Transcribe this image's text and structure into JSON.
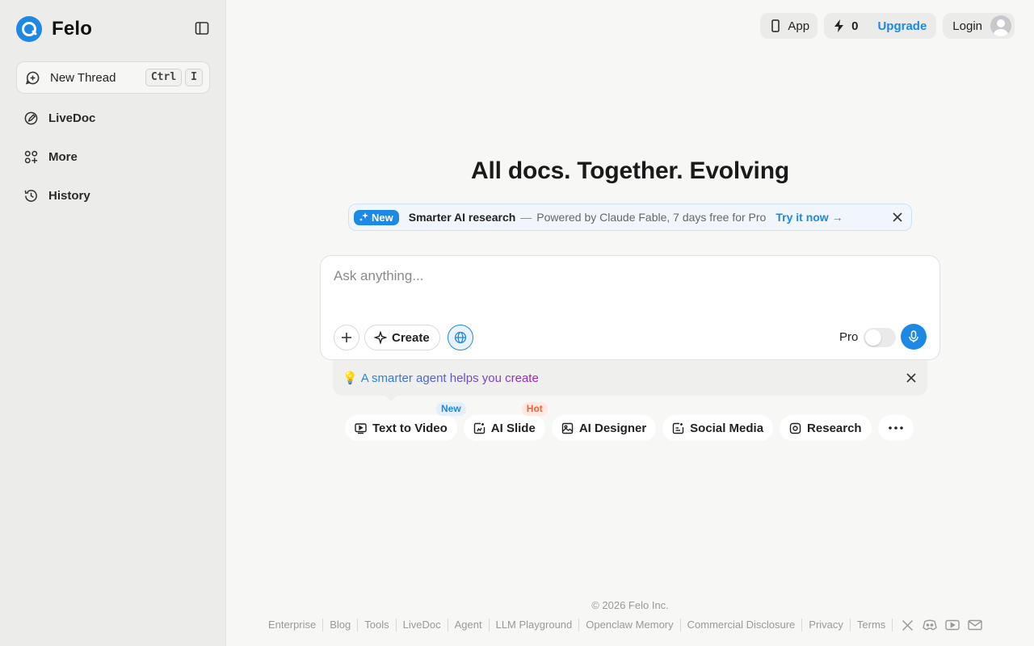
{
  "brand": {
    "name": "Felo"
  },
  "sidebar": {
    "new_thread": {
      "label": "New Thread",
      "keys": [
        "Ctrl",
        "I"
      ]
    },
    "items": [
      {
        "label": "LiveDoc",
        "icon": "edit-icon"
      },
      {
        "label": "More",
        "icon": "apps-plus-icon"
      },
      {
        "label": "History",
        "icon": "history-icon"
      }
    ]
  },
  "topbar": {
    "app_label": "App",
    "credits": "0",
    "upgrade_label": "Upgrade",
    "login_label": "Login"
  },
  "hero": {
    "title": "All docs. Together. Evolving"
  },
  "promo": {
    "badge": "New",
    "title": "Smarter AI research",
    "dash": "—",
    "text": "Powered by Claude Fable, 7 days free for Pro",
    "link": "Try it now →"
  },
  "composer": {
    "placeholder": "Ask anything...",
    "create_label": "Create",
    "pro_label": "Pro",
    "pro_enabled": false
  },
  "tip": {
    "emoji": "💡",
    "text": "A smarter agent helps you create"
  },
  "chips": [
    {
      "label": "Text to Video",
      "badge": "New",
      "icon": "video-icon"
    },
    {
      "label": "AI Slide",
      "badge": "Hot",
      "icon": "slide-icon"
    },
    {
      "label": "AI Designer",
      "badge": "",
      "icon": "image-icon"
    },
    {
      "label": "Social Media",
      "badge": "",
      "icon": "social-icon"
    },
    {
      "label": "Research",
      "badge": "",
      "icon": "research-icon"
    }
  ],
  "footer": {
    "copyright": "© 2026  Felo Inc.",
    "links": [
      "Enterprise",
      "Blog",
      "Tools",
      "LiveDoc",
      "Agent",
      "LLM Playground",
      "Openclaw Memory",
      "Commercial Disclosure",
      "Privacy",
      "Terms"
    ],
    "social": [
      "x-icon",
      "discord-icon",
      "youtube-icon",
      "mail-icon"
    ]
  },
  "colors": {
    "accent": "#1e88e5",
    "sidebar_bg": "#ececea",
    "page_bg": "#f7f7f5"
  }
}
